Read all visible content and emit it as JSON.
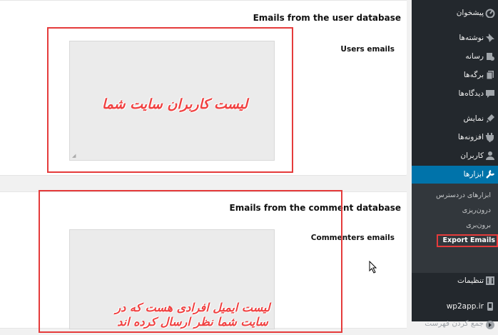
{
  "main": {
    "section1": {
      "heading": "Emails from the user database",
      "label": "Users emails",
      "annotation": "لیست کاربران سایت شما"
    },
    "section2": {
      "heading": "Emails from the comment database",
      "label": "Commenters emails",
      "annotation_line1": "لیست ایمیل افرادی هست که در",
      "annotation_line2": "سایت شما نظر ارسال کرده اند"
    }
  },
  "sidebar": {
    "items": [
      {
        "label": "پیشخوان",
        "icon": "dashboard-icon"
      },
      {
        "label": "نوشته‌ها",
        "icon": "pin-icon"
      },
      {
        "label": "رسانه",
        "icon": "media-icon"
      },
      {
        "label": "برگه‌ها",
        "icon": "pages-icon"
      },
      {
        "label": "دیدگاه‌ها",
        "icon": "comments-icon"
      },
      {
        "label": "نمایش",
        "icon": "appearance-icon"
      },
      {
        "label": "افزونه‌ها",
        "icon": "plugins-icon"
      },
      {
        "label": "کاربران",
        "icon": "users-icon"
      },
      {
        "label": "ابزارها",
        "icon": "tools-icon",
        "active": true
      }
    ],
    "submenu": [
      {
        "label": "ابزارهای دردسترس"
      },
      {
        "label": "درون‌ریزی"
      },
      {
        "label": "برون‌بری"
      },
      {
        "label": "Export Emails",
        "current": true
      }
    ],
    "bottom": [
      {
        "label": "تنظیمات",
        "icon": "settings-icon"
      },
      {
        "label": "wp2app.ir",
        "icon": "wp2app-icon"
      },
      {
        "label": "جمع کردن فهرست",
        "icon": "collapse-icon"
      }
    ]
  },
  "colors": {
    "sidebar_bg": "#23282d",
    "submenu_bg": "#32373c",
    "active_bg": "#0073aa",
    "annotation_red": "#e53b3b"
  }
}
